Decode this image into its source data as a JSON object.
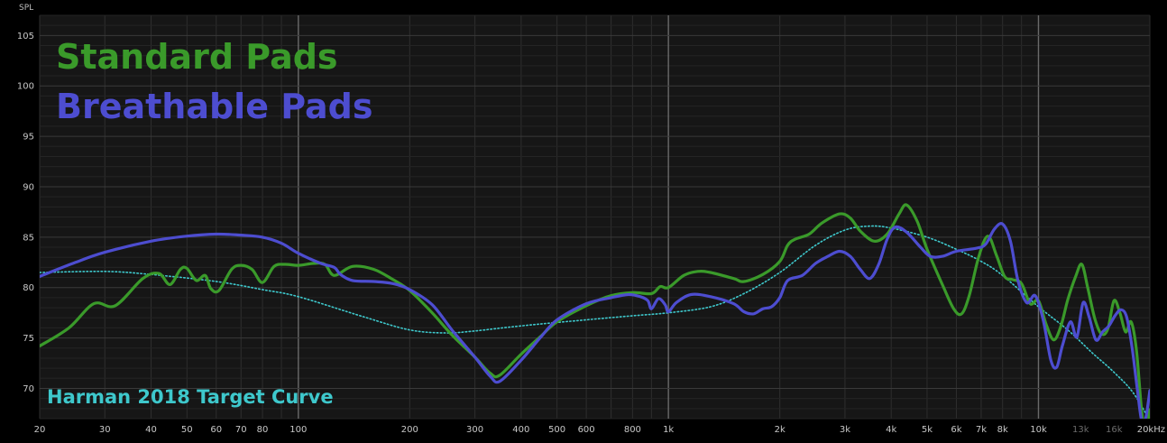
{
  "chart_data": {
    "type": "line",
    "ylabel": "SPL",
    "xunit": "kHz",
    "xscale": "log",
    "xlim": [
      20,
      20000
    ],
    "ylim": [
      67,
      107
    ],
    "grid": true,
    "legend_placement": "top-left",
    "x_tick_labels": [
      {
        "x": 20,
        "label": "20",
        "dim": false
      },
      {
        "x": 30,
        "label": "30",
        "dim": false
      },
      {
        "x": 40,
        "label": "40",
        "dim": false
      },
      {
        "x": 50,
        "label": "50",
        "dim": false
      },
      {
        "x": 60,
        "label": "60",
        "dim": false
      },
      {
        "x": 70,
        "label": "70",
        "dim": false
      },
      {
        "x": 80,
        "label": "80",
        "dim": false
      },
      {
        "x": 100,
        "label": "100",
        "dim": false
      },
      {
        "x": 200,
        "label": "200",
        "dim": false
      },
      {
        "x": 300,
        "label": "300",
        "dim": false
      },
      {
        "x": 400,
        "label": "400",
        "dim": false
      },
      {
        "x": 500,
        "label": "500",
        "dim": false
      },
      {
        "x": 600,
        "label": "600",
        "dim": false
      },
      {
        "x": 800,
        "label": "800",
        "dim": false
      },
      {
        "x": 1000,
        "label": "1k",
        "dim": false
      },
      {
        "x": 2000,
        "label": "2k",
        "dim": false
      },
      {
        "x": 3000,
        "label": "3k",
        "dim": false
      },
      {
        "x": 4000,
        "label": "4k",
        "dim": false
      },
      {
        "x": 5000,
        "label": "5k",
        "dim": false
      },
      {
        "x": 6000,
        "label": "6k",
        "dim": false
      },
      {
        "x": 7000,
        "label": "7k",
        "dim": false
      },
      {
        "x": 8000,
        "label": "8k",
        "dim": false
      },
      {
        "x": 10000,
        "label": "10k",
        "dim": false
      },
      {
        "x": 13000,
        "label": "13k",
        "dim": true
      },
      {
        "x": 16000,
        "label": "16k",
        "dim": true
      },
      {
        "x": 20000,
        "label": "20kHz",
        "dim": false
      }
    ],
    "y_ticks": [
      70,
      75,
      80,
      85,
      90,
      95,
      100,
      105
    ],
    "series": [
      {
        "name": "Standard Pads",
        "color": "#3a9a2a",
        "width": 3.2,
        "dashed": false,
        "points": [
          [
            20,
            74.2
          ],
          [
            24,
            76
          ],
          [
            28,
            78.4
          ],
          [
            32,
            78.2
          ],
          [
            38,
            80.9
          ],
          [
            42,
            81.4
          ],
          [
            45,
            80.3
          ],
          [
            48,
            81.8
          ],
          [
            50,
            81.9
          ],
          [
            53,
            80.7
          ],
          [
            56,
            81.2
          ],
          [
            58,
            79.9
          ],
          [
            61,
            79.7
          ],
          [
            66,
            81.8
          ],
          [
            70,
            82.2
          ],
          [
            75,
            81.8
          ],
          [
            80,
            80.5
          ],
          [
            86,
            82.1
          ],
          [
            92,
            82.3
          ],
          [
            100,
            82.2
          ],
          [
            110,
            82.4
          ],
          [
            118,
            82.3
          ],
          [
            125,
            81.2
          ],
          [
            140,
            82.1
          ],
          [
            160,
            81.8
          ],
          [
            180,
            80.8
          ],
          [
            200,
            79.7
          ],
          [
            230,
            77.5
          ],
          [
            260,
            75.3
          ],
          [
            300,
            73.1
          ],
          [
            330,
            71.5
          ],
          [
            350,
            71.3
          ],
          [
            400,
            73.4
          ],
          [
            450,
            75.1
          ],
          [
            500,
            76.6
          ],
          [
            600,
            78.2
          ],
          [
            700,
            79.2
          ],
          [
            800,
            79.5
          ],
          [
            900,
            79.4
          ],
          [
            950,
            80.1
          ],
          [
            1000,
            80
          ],
          [
            1100,
            81.2
          ],
          [
            1200,
            81.6
          ],
          [
            1300,
            81.5
          ],
          [
            1500,
            80.9
          ],
          [
            1600,
            80.6
          ],
          [
            1800,
            81.3
          ],
          [
            2000,
            82.6
          ],
          [
            2100,
            84.2
          ],
          [
            2200,
            84.8
          ],
          [
            2400,
            85.3
          ],
          [
            2600,
            86.4
          ],
          [
            2900,
            87.3
          ],
          [
            3100,
            86.9
          ],
          [
            3300,
            85.6
          ],
          [
            3600,
            84.6
          ],
          [
            3900,
            85.3
          ],
          [
            4200,
            87.3
          ],
          [
            4400,
            88.2
          ],
          [
            4700,
            86.6
          ],
          [
            5000,
            83.8
          ],
          [
            5500,
            80.3
          ],
          [
            5900,
            77.9
          ],
          [
            6200,
            77.4
          ],
          [
            6500,
            79.2
          ],
          [
            6900,
            83.1
          ],
          [
            7300,
            85.1
          ],
          [
            7700,
            83.2
          ],
          [
            8100,
            81.1
          ],
          [
            8500,
            80.8
          ],
          [
            9000,
            80.4
          ],
          [
            9500,
            78.4
          ],
          [
            10000,
            78.7
          ],
          [
            10500,
            76.3
          ],
          [
            11000,
            74.8
          ],
          [
            11500,
            76.2
          ],
          [
            12000,
            78.8
          ],
          [
            12600,
            81.1
          ],
          [
            13100,
            82.3
          ],
          [
            13600,
            79.9
          ],
          [
            14200,
            76.9
          ],
          [
            14800,
            75.4
          ],
          [
            15400,
            75.9
          ],
          [
            16000,
            78.7
          ],
          [
            16600,
            77.5
          ],
          [
            17200,
            75.6
          ],
          [
            17800,
            76.6
          ],
          [
            18400,
            73.8
          ],
          [
            19000,
            67.8
          ],
          [
            19500,
            65.5
          ],
          [
            20000,
            67.9
          ]
        ]
      },
      {
        "name": "Breathable Pads",
        "color": "#4d4dd0",
        "width": 3.2,
        "dashed": false,
        "points": [
          [
            20,
            81.1
          ],
          [
            25,
            82.5
          ],
          [
            30,
            83.5
          ],
          [
            40,
            84.6
          ],
          [
            50,
            85.1
          ],
          [
            60,
            85.3
          ],
          [
            70,
            85.2
          ],
          [
            80,
            85
          ],
          [
            90,
            84.4
          ],
          [
            100,
            83.4
          ],
          [
            115,
            82.4
          ],
          [
            125,
            82
          ],
          [
            130,
            81.3
          ],
          [
            140,
            80.7
          ],
          [
            160,
            80.6
          ],
          [
            180,
            80.4
          ],
          [
            200,
            79.8
          ],
          [
            230,
            78.3
          ],
          [
            260,
            75.8
          ],
          [
            300,
            73.1
          ],
          [
            330,
            71.2
          ],
          [
            350,
            70.7
          ],
          [
            400,
            72.8
          ],
          [
            450,
            75
          ],
          [
            500,
            76.8
          ],
          [
            600,
            78.4
          ],
          [
            700,
            79
          ],
          [
            780,
            79.3
          ],
          [
            840,
            79.1
          ],
          [
            880,
            78.7
          ],
          [
            900,
            77.9
          ],
          [
            940,
            78.9
          ],
          [
            980,
            78.3
          ],
          [
            1000,
            77.6
          ],
          [
            1050,
            78.5
          ],
          [
            1150,
            79.3
          ],
          [
            1300,
            79.1
          ],
          [
            1500,
            78.4
          ],
          [
            1600,
            77.6
          ],
          [
            1700,
            77.4
          ],
          [
            1800,
            77.9
          ],
          [
            1900,
            78.1
          ],
          [
            2000,
            79
          ],
          [
            2100,
            80.7
          ],
          [
            2300,
            81.2
          ],
          [
            2500,
            82.4
          ],
          [
            2700,
            83.1
          ],
          [
            2900,
            83.6
          ],
          [
            3100,
            83.1
          ],
          [
            3300,
            81.8
          ],
          [
            3500,
            80.9
          ],
          [
            3700,
            82.3
          ],
          [
            3900,
            84.8
          ],
          [
            4100,
            86
          ],
          [
            4400,
            85.5
          ],
          [
            4800,
            84
          ],
          [
            5100,
            83.1
          ],
          [
            5500,
            83.1
          ],
          [
            6000,
            83.6
          ],
          [
            6800,
            83.9
          ],
          [
            7200,
            84.3
          ],
          [
            7600,
            85.8
          ],
          [
            8000,
            86.3
          ],
          [
            8400,
            84.6
          ],
          [
            8800,
            80.7
          ],
          [
            9300,
            78.5
          ],
          [
            9800,
            79.2
          ],
          [
            10300,
            76.8
          ],
          [
            10800,
            72.8
          ],
          [
            11200,
            72.1
          ],
          [
            11600,
            74.2
          ],
          [
            12200,
            76.6
          ],
          [
            12700,
            75.1
          ],
          [
            13200,
            78.5
          ],
          [
            13700,
            77.1
          ],
          [
            14300,
            74.8
          ],
          [
            14900,
            75.6
          ],
          [
            15500,
            76.2
          ],
          [
            16100,
            77.2
          ],
          [
            16700,
            77.8
          ],
          [
            17300,
            77.1
          ],
          [
            17900,
            74.1
          ],
          [
            18500,
            69.9
          ],
          [
            19000,
            66.8
          ],
          [
            19500,
            67.1
          ],
          [
            20000,
            69.8
          ]
        ]
      },
      {
        "name": "Harman 2018 Target Curve",
        "color": "#3ec8cc",
        "width": 1.6,
        "dashed": true,
        "points": [
          [
            20,
            81.5
          ],
          [
            30,
            81.6
          ],
          [
            40,
            81.3
          ],
          [
            60,
            80.6
          ],
          [
            80,
            79.8
          ],
          [
            100,
            79.1
          ],
          [
            150,
            77.1
          ],
          [
            200,
            75.8
          ],
          [
            250,
            75.5
          ],
          [
            300,
            75.7
          ],
          [
            400,
            76.2
          ],
          [
            600,
            76.8
          ],
          [
            800,
            77.2
          ],
          [
            1000,
            77.5
          ],
          [
            1300,
            78.1
          ],
          [
            1600,
            79.4
          ],
          [
            2000,
            81.5
          ],
          [
            2500,
            84.2
          ],
          [
            3000,
            85.7
          ],
          [
            3500,
            86.1
          ],
          [
            4000,
            85.9
          ],
          [
            5000,
            85
          ],
          [
            6000,
            83.8
          ],
          [
            7000,
            82.6
          ],
          [
            8000,
            81.2
          ],
          [
            10000,
            78.1
          ],
          [
            12000,
            75.8
          ],
          [
            14000,
            73.5
          ],
          [
            16000,
            71.6
          ],
          [
            18000,
            69.6
          ],
          [
            20000,
            66.8
          ]
        ]
      }
    ]
  }
}
